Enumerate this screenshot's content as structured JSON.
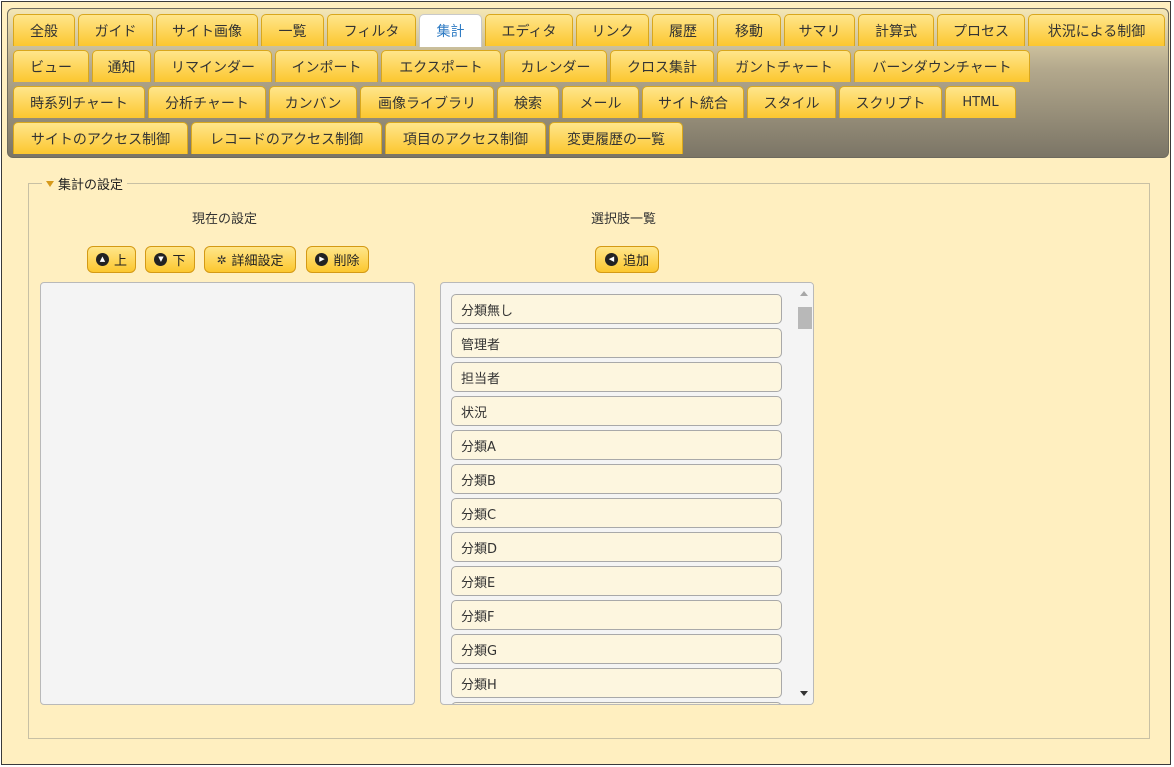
{
  "tabs": {
    "row1": [
      "全般",
      "ガイド",
      "サイト画像",
      "一覧",
      "フィルタ",
      "集計",
      "エディタ",
      "リンク",
      "履歴",
      "移動",
      "サマリ",
      "計算式",
      "プロセス",
      "状況による制御"
    ],
    "row2": [
      "ビュー",
      "通知",
      "リマインダー",
      "インポート",
      "エクスポート",
      "カレンダー",
      "クロス集計",
      "ガントチャート",
      "バーンダウンチャート"
    ],
    "row3": [
      "時系列チャート",
      "分析チャート",
      "カンバン",
      "画像ライブラリ",
      "検索",
      "メール",
      "サイト統合",
      "スタイル",
      "スクリプト",
      "HTML"
    ],
    "row4": [
      "サイトのアクセス制御",
      "レコードのアクセス制御",
      "項目のアクセス制御",
      "変更履歴の一覧"
    ],
    "active": "集計"
  },
  "section": {
    "legend": "集計の設定"
  },
  "current": {
    "heading": "現在の設定",
    "buttons": {
      "up": "上",
      "down": "下",
      "advanced": "詳細設定",
      "delete": "削除"
    },
    "items": []
  },
  "choices": {
    "heading": "選択肢一覧",
    "add_label": "追加",
    "items": [
      "分類無し",
      "管理者",
      "担当者",
      "状況",
      "分類A",
      "分類B",
      "分類C",
      "分類D",
      "分類E",
      "分類F",
      "分類G",
      "分類H"
    ]
  },
  "icons": {
    "up": "circle-chevron-up-icon",
    "down": "circle-chevron-down-icon",
    "advanced": "gear-icon",
    "delete": "circle-chevron-right-icon",
    "add": "circle-chevron-left-icon"
  },
  "colors": {
    "tab": "#fcc72e",
    "active_tab_text": "#2e7bc4",
    "background": "#ffefc0"
  }
}
